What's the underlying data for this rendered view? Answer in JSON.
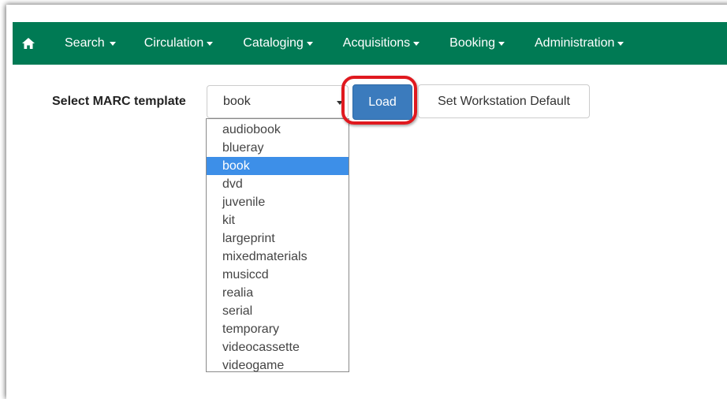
{
  "nav": {
    "home_icon": "home-icon",
    "items": [
      {
        "label": "Search"
      },
      {
        "label": "Circulation"
      },
      {
        "label": "Cataloging"
      },
      {
        "label": "Acquisitions"
      },
      {
        "label": "Booking"
      },
      {
        "label": "Administration"
      }
    ]
  },
  "form": {
    "label": "Select MARC template",
    "selected": "book",
    "options": [
      "audiobook",
      "blueray",
      "book",
      "dvd",
      "juvenile",
      "kit",
      "largeprint",
      "mixedmaterials",
      "musiccd",
      "realia",
      "serial",
      "temporary",
      "videocassette",
      "videogame"
    ],
    "load_label": "Load",
    "default_label": "Set Workstation Default"
  },
  "colors": {
    "navbar": "#007a54",
    "primary_button": "#3b7bbd",
    "selected_option": "#3d8fe8",
    "highlight": "#e0191f"
  }
}
